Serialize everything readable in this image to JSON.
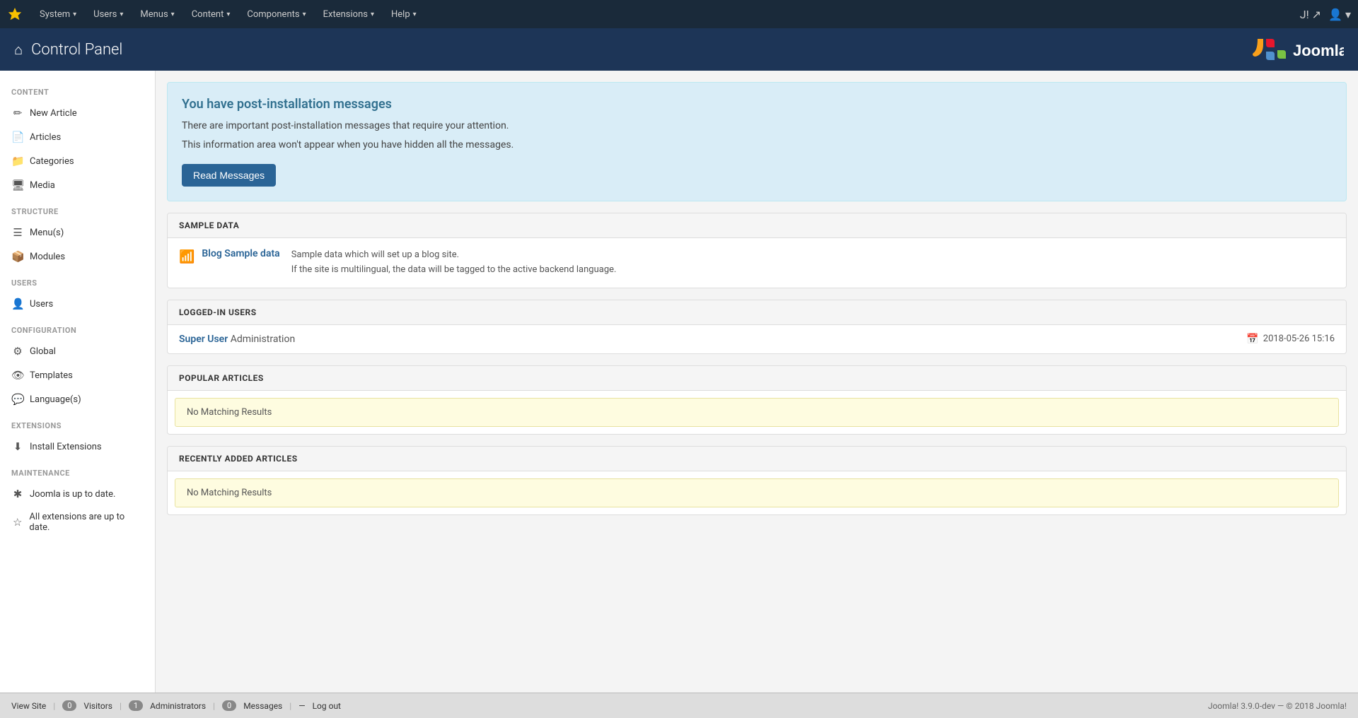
{
  "topnav": {
    "brand_icon": "✳",
    "items": [
      {
        "label": "System",
        "id": "system"
      },
      {
        "label": "Users",
        "id": "users"
      },
      {
        "label": "Menus",
        "id": "menus"
      },
      {
        "label": "Content",
        "id": "content"
      },
      {
        "label": "Components",
        "id": "components"
      },
      {
        "label": "Extensions",
        "id": "extensions"
      },
      {
        "label": "Help",
        "id": "help"
      }
    ],
    "right_label1": "J!",
    "right_icon": "👤"
  },
  "header": {
    "title": "Control Panel",
    "home_icon": "⌂"
  },
  "sidebar": {
    "sections": [
      {
        "label": "CONTENT",
        "items": [
          {
            "label": "New Article",
            "icon": "✏",
            "id": "new-article"
          },
          {
            "label": "Articles",
            "icon": "📄",
            "id": "articles"
          },
          {
            "label": "Categories",
            "icon": "📁",
            "id": "categories"
          },
          {
            "label": "Media",
            "icon": "🖥",
            "id": "media"
          }
        ]
      },
      {
        "label": "STRUCTURE",
        "items": [
          {
            "label": "Menu(s)",
            "icon": "☰",
            "id": "menus"
          },
          {
            "label": "Modules",
            "icon": "📦",
            "id": "modules"
          }
        ]
      },
      {
        "label": "USERS",
        "items": [
          {
            "label": "Users",
            "icon": "👤",
            "id": "users"
          }
        ]
      },
      {
        "label": "CONFIGURATION",
        "items": [
          {
            "label": "Global",
            "icon": "⚙",
            "id": "global"
          },
          {
            "label": "Templates",
            "icon": "👁",
            "id": "templates"
          },
          {
            "label": "Language(s)",
            "icon": "💬",
            "id": "languages"
          }
        ]
      },
      {
        "label": "EXTENSIONS",
        "items": [
          {
            "label": "Install Extensions",
            "icon": "⬇",
            "id": "install-extensions"
          }
        ]
      },
      {
        "label": "MAINTENANCE",
        "items": [
          {
            "label": "Joomla is up to date.",
            "icon": "✱",
            "id": "joomla-update"
          },
          {
            "label": "All extensions are up to date.",
            "icon": "☆",
            "id": "ext-update"
          }
        ]
      }
    ]
  },
  "notice": {
    "title": "You have post-installation messages",
    "line1": "There are important post-installation messages that require your attention.",
    "line2": "This information area won't appear when you have hidden all the messages.",
    "button_label": "Read Messages"
  },
  "sample_data": {
    "heading": "SAMPLE DATA",
    "items": [
      {
        "icon": "📶",
        "link": "Blog Sample data",
        "desc1": "Sample data which will set up a blog site.",
        "desc2": "If the site is multilingual, the data will be tagged to the active backend language."
      }
    ]
  },
  "logged_in_users": {
    "heading": "LOGGED-IN USERS",
    "items": [
      {
        "name": "Super User",
        "role": "Administration",
        "time": "2018-05-26 15:16",
        "cal_icon": "📅"
      }
    ]
  },
  "popular_articles": {
    "heading": "POPULAR ARTICLES",
    "no_results": "No Matching Results"
  },
  "recently_added": {
    "heading": "RECENTLY ADDED ARTICLES",
    "no_results": "No Matching Results"
  },
  "footer": {
    "view_site": "View Site",
    "visitors_count": "0",
    "visitors_label": "Visitors",
    "admins_count": "1",
    "admins_label": "Administrators",
    "messages_count": "0",
    "messages_label": "Messages",
    "logout_icon": "—",
    "logout_label": "Log out",
    "version": "Joomla! 3.9.0-dev — © 2018 Joomla!"
  }
}
